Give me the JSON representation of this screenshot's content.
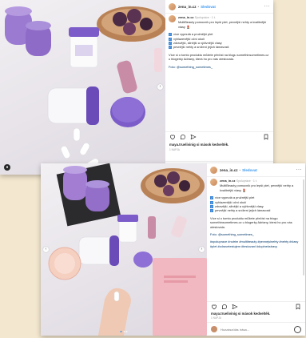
{
  "post": {
    "username": "zena_in.cz",
    "follow_label": "Sledovat",
    "more_label": "···",
    "caption": {
      "meta": "Spolupráce · 1 t.",
      "intro": "MultiBeauty pomocník pro lepší plet, pevnější nehty a kvalitnější vlasy 💄",
      "bullets": [
        "více vypnutá a pružnější plet",
        "vyhlazenější oční okolí",
        "zdravější, silnější a výživnější vlasy",
        "pevnější nehty a snížení jejich lámavosti"
      ],
      "more_text": "Více si o tomto produktu můžete přečíst na blogu somethinsometimes.cz u blogerky Adriany, která ho pro nás otestovala.",
      "photo_credit": "Foto: @something_sometimes_",
      "hashtags": "#spoluprace #nutrim #multibeauty #pevnejsinehty #nehty #vlasy #plet #zdravetestujem #testovani #doplnekstravy"
    },
    "liked_by": "maya.truelivinig si mások kedvelték.",
    "time_ago": "1 NAPJA",
    "comment_placeholder": "Hozzászólás írása..."
  },
  "colors": {
    "link_blue": "#3897f0",
    "bg": "#f3e7cf",
    "purple_cap": "#7b5cc9"
  },
  "icons": [
    "heart-icon",
    "comment-icon",
    "share-icon",
    "bookmark-icon",
    "more-icon",
    "user-tag-icon",
    "emoji-icon"
  ]
}
